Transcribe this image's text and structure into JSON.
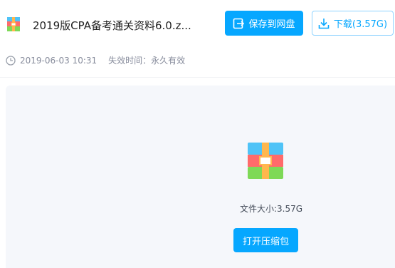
{
  "file": {
    "title": "2019版CPA备考通关资料6.0.z...",
    "icon": "zip-archive-icon"
  },
  "actions": {
    "save_label": "保存到网盘",
    "download_label": "下载(3.57G)"
  },
  "meta": {
    "date": "2019-06-03 10:31",
    "expire_text": "失效时间：永久有效"
  },
  "preview": {
    "size_text": "文件大小:3.57G",
    "open_label": "打开压缩包"
  },
  "colors": {
    "accent": "#06a7ff",
    "preview_bg": "#f5f7fb"
  }
}
